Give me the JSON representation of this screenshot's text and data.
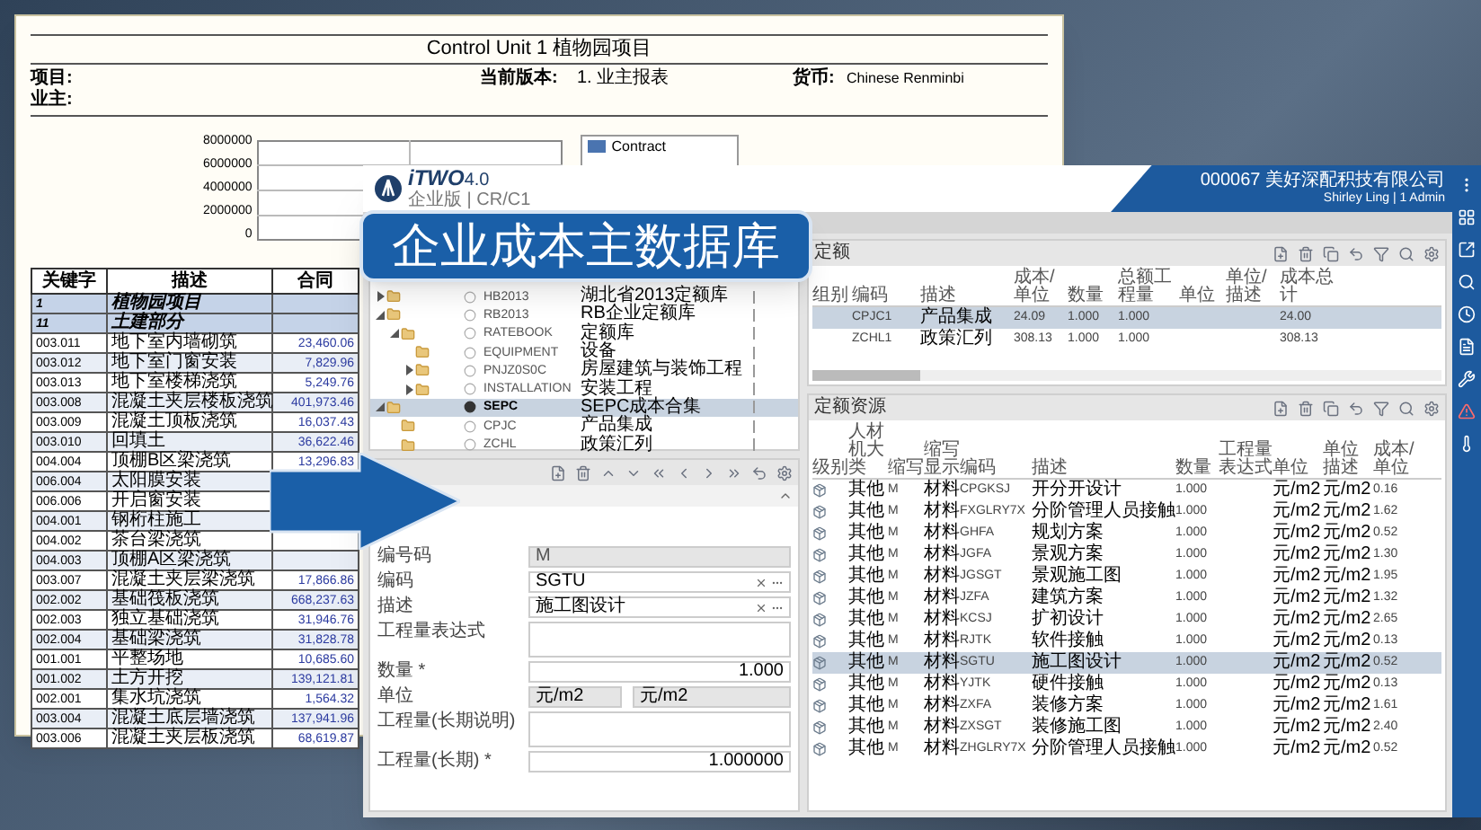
{
  "report": {
    "title": "Control Unit 1 植物园项目",
    "fields": [
      {
        "label": "项目:"
      },
      {
        "label": "当前版本:",
        "value": "1. 业主报表"
      },
      {
        "label": "货币:",
        "value": "Chinese Renminbi"
      },
      {
        "label": "业主:"
      }
    ],
    "chart": {
      "y_axis_labels": [
        "8000000",
        "6000000",
        "4000000",
        "2000000",
        "0"
      ],
      "legend": [
        "Contract"
      ]
    },
    "table": {
      "columns": [
        "关键字",
        "描述",
        "合同"
      ],
      "rows": [
        {
          "kind": "group",
          "key": "1",
          "description": "植物园项目"
        },
        {
          "kind": "group",
          "key": "11",
          "description": "土建部分"
        },
        {
          "kind": "item",
          "key": "003.011",
          "description": "地下室内墙砌筑",
          "amount": "23,460.06"
        },
        {
          "kind": "item",
          "key": "003.012",
          "description": "地下室门窗安装",
          "amount": "7,829.96"
        },
        {
          "kind": "item",
          "key": "003.013",
          "description": "地下室楼梯浇筑",
          "amount": "5,249.76"
        },
        {
          "kind": "item",
          "key": "003.008",
          "description": "混凝土夹层楼板浇筑",
          "amount": "401,973.46"
        },
        {
          "kind": "item",
          "key": "003.009",
          "description": "混凝土顶板浇筑",
          "amount": "16,037.43"
        },
        {
          "kind": "item",
          "key": "003.010",
          "description": "回填土",
          "amount": "36,622.46"
        },
        {
          "kind": "item",
          "key": "004.004",
          "description": "顶棚B区梁浇筑",
          "amount": "13,296.83"
        },
        {
          "kind": "item",
          "key": "006.004",
          "description": "太阳膜安装"
        },
        {
          "kind": "item",
          "key": "006.006",
          "description": "开启窗安装"
        },
        {
          "kind": "item",
          "key": "004.001",
          "description": "钢桁柱施工"
        },
        {
          "kind": "item",
          "key": "004.002",
          "description": "茶台梁浇筑"
        },
        {
          "kind": "item",
          "key": "004.003",
          "description": "顶棚A区梁浇筑"
        },
        {
          "kind": "item",
          "key": "003.007",
          "description": "混凝土夹层梁浇筑",
          "amount": "17,866.86"
        },
        {
          "kind": "item",
          "key": "002.002",
          "description": "基础筏板浇筑",
          "amount": "668,237.63"
        },
        {
          "kind": "item",
          "key": "002.003",
          "description": "独立基础浇筑",
          "amount": "31,946.76"
        },
        {
          "kind": "item",
          "key": "002.004",
          "description": "基础梁浇筑",
          "amount": "31,828.78"
        },
        {
          "kind": "item",
          "key": "001.001",
          "description": "平整场地",
          "amount": "10,685.60"
        },
        {
          "kind": "item",
          "key": "001.002",
          "description": "土方开挖",
          "amount": "139,121.81"
        },
        {
          "kind": "item",
          "key": "002.001",
          "description": "集水坑浇筑",
          "amount": "1,564.32"
        },
        {
          "kind": "item",
          "key": "003.004",
          "description": "混凝土底层墙浇筑",
          "amount": "137,941.96"
        },
        {
          "kind": "item",
          "key": "003.006",
          "description": "混凝土夹层板浇筑",
          "amount": "68,619.87"
        }
      ]
    }
  },
  "app": {
    "logo": "iTWO",
    "version": "4.0",
    "subtitle": "企业版 | CR/C1",
    "account": "000067 美好深配积技有限公司",
    "user": "Shirley Ling | 1 Admin"
  },
  "overlay_label": "企业成本主数据库",
  "tree": [
    {
      "code": "HB2013",
      "description": "湖北省2013定额库",
      "kind": "group",
      "expanded": false,
      "selected": false
    },
    {
      "code": "RB2013",
      "description": "RB企业定额库",
      "kind": "group",
      "expanded": true,
      "selected": false,
      "children": [
        {
          "code": "RATEBOOK",
          "description": "定额库",
          "kind": "group",
          "expanded": true,
          "selected": false,
          "children": [
            {
              "code": "EQUIPMENT",
              "description": "设备",
              "kind": "leaf",
              "selected": false
            },
            {
              "code": "PNJZ0S0C",
              "description": "房屋建筑与装饰工程",
              "kind": "group",
              "expanded": false,
              "selected": false
            },
            {
              "code": "INSTALLATION",
              "description": "安装工程",
              "kind": "group",
              "expanded": false,
              "selected": false
            }
          ]
        }
      ]
    },
    {
      "code": "SEPC",
      "description": "SEPC成本合集",
      "kind": "group",
      "expanded": true,
      "selected": true,
      "children": [
        {
          "code": "CPJC",
          "description": "产品集成",
          "kind": "leaf",
          "selected": false
        },
        {
          "code": "ZCHL",
          "description": "政策汇列",
          "kind": "leaf",
          "selected": false
        }
      ]
    }
  ],
  "form": {
    "fields": [
      {
        "label": "编号码",
        "kind": "readonly",
        "value": "M"
      },
      {
        "label": "编码",
        "kind": "lookup",
        "value": "SGTU"
      },
      {
        "label": "描述",
        "kind": "lookup",
        "value": "施工图设计"
      },
      {
        "label": "工程量表达式",
        "kind": "textarea"
      },
      {
        "label": "数量 *",
        "kind": "number",
        "value": "1.000"
      },
      {
        "label": "单位",
        "kind": "pair",
        "value": "元/m2",
        "value2": "元/m2"
      },
      {
        "label": "工程量(长期说明)",
        "kind": "textarea"
      },
      {
        "label": "工程量(长期) *",
        "kind": "number",
        "value": "1.000000"
      }
    ]
  },
  "rates": {
    "title": "定额",
    "columns": [
      "组别",
      "编码",
      "描述",
      "成本/单位",
      "数量",
      "总额工程量",
      "单位",
      "单位/描述",
      "成本总计"
    ],
    "rows": [
      {
        "selected": true,
        "cells": [
          "",
          "CPJC1",
          "产品集成",
          "24.09",
          "1.000",
          "1.000",
          "",
          "",
          "24.00"
        ]
      },
      {
        "selected": false,
        "cells": [
          "",
          "ZCHL1",
          "政策汇列",
          "308.13",
          "1.000",
          "1.000",
          "",
          "",
          "308.13"
        ]
      }
    ]
  },
  "resources": {
    "title": "定额资源",
    "columns": [
      "级别",
      "人材机大类",
      "缩写",
      "缩写显示",
      "编码",
      "描述",
      "数量",
      "工程量表达式",
      "单位",
      "单位描述",
      "成本/单位"
    ],
    "rows": [
      {
        "selected": false,
        "cells": [
          "",
          "其他",
          "M",
          "材料",
          "CPGKSJ",
          "开分开设计",
          "1.000",
          "",
          "元/m2",
          "元/m2",
          "0.16"
        ]
      },
      {
        "selected": false,
        "cells": [
          "",
          "其他",
          "M",
          "材料",
          "FXGLRY7X",
          "分阶管理人员接触",
          "1.000",
          "",
          "元/m2",
          "元/m2",
          "1.62"
        ]
      },
      {
        "selected": false,
        "cells": [
          "",
          "其他",
          "M",
          "材料",
          "GHFA",
          "规划方案",
          "1.000",
          "",
          "元/m2",
          "元/m2",
          "0.52"
        ]
      },
      {
        "selected": false,
        "cells": [
          "",
          "其他",
          "M",
          "材料",
          "JGFA",
          "景观方案",
          "1.000",
          "",
          "元/m2",
          "元/m2",
          "1.30"
        ]
      },
      {
        "selected": false,
        "cells": [
          "",
          "其他",
          "M",
          "材料",
          "JGSGT",
          "景观施工图",
          "1.000",
          "",
          "元/m2",
          "元/m2",
          "1.95"
        ]
      },
      {
        "selected": false,
        "cells": [
          "",
          "其他",
          "M",
          "材料",
          "JZFA",
          "建筑方案",
          "1.000",
          "",
          "元/m2",
          "元/m2",
          "1.32"
        ]
      },
      {
        "selected": false,
        "cells": [
          "",
          "其他",
          "M",
          "材料",
          "KCSJ",
          "扩初设计",
          "1.000",
          "",
          "元/m2",
          "元/m2",
          "2.65"
        ]
      },
      {
        "selected": false,
        "cells": [
          "",
          "其他",
          "M",
          "材料",
          "RJTK",
          "软件接触",
          "1.000",
          "",
          "元/m2",
          "元/m2",
          "0.13"
        ]
      },
      {
        "selected": true,
        "cells": [
          "",
          "其他",
          "M",
          "材料",
          "SGTU",
          "施工图设计",
          "1.000",
          "",
          "元/m2",
          "元/m2",
          "0.52"
        ]
      },
      {
        "selected": false,
        "cells": [
          "",
          "其他",
          "M",
          "材料",
          "YJTK",
          "硬件接触",
          "1.000",
          "",
          "元/m2",
          "元/m2",
          "0.13"
        ]
      },
      {
        "selected": false,
        "cells": [
          "",
          "其他",
          "M",
          "材料",
          "ZXFA",
          "装修方案",
          "1.000",
          "",
          "元/m2",
          "元/m2",
          "1.61"
        ]
      },
      {
        "selected": false,
        "cells": [
          "",
          "其他",
          "M",
          "材料",
          "ZXSGT",
          "装修施工图",
          "1.000",
          "",
          "元/m2",
          "元/m2",
          "2.40"
        ]
      },
      {
        "selected": false,
        "cells": [
          "",
          "其他",
          "M",
          "材料",
          "ZHGLRY7X",
          "分阶管理人员接触",
          "1.000",
          "",
          "元/m2",
          "元/m2",
          "0.52"
        ]
      }
    ]
  }
}
